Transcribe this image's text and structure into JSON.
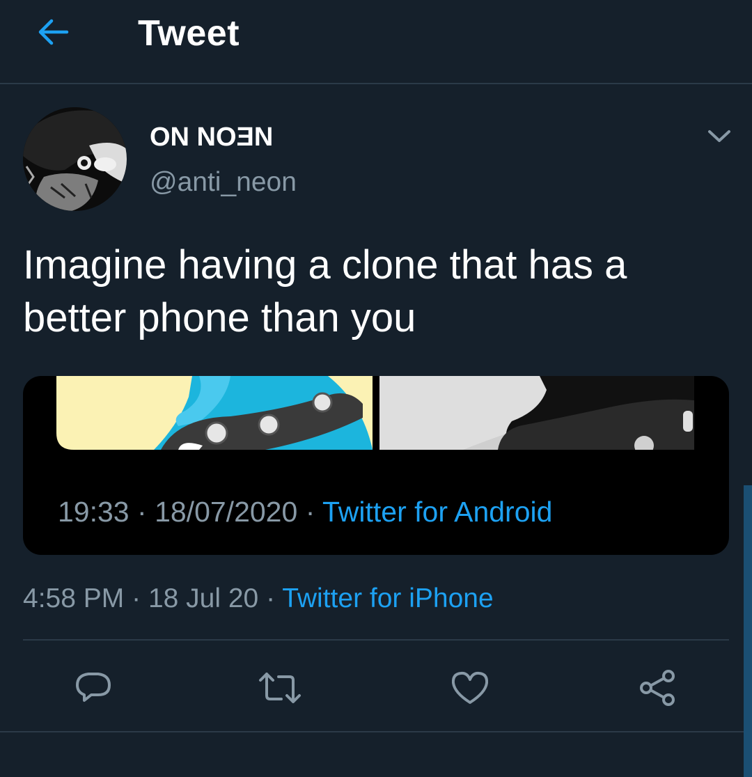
{
  "header": {
    "title": "Tweet",
    "back_icon": "arrow-left-icon"
  },
  "colors": {
    "background": "#15202b",
    "accent": "#1da1f2",
    "secondary_text": "#8899a6",
    "divider": "#2b3a48"
  },
  "tweet": {
    "display_name": "ON NOƎN",
    "handle": "@anti_neon",
    "text_lines": [
      "Imagine having a clone that has a",
      "better phone than you"
    ],
    "media": {
      "time": "19:33",
      "date": "18/07/2020",
      "separator": "·",
      "source": "Twitter for Android"
    },
    "time": "4:58 PM",
    "date": "18 Jul 20",
    "separator": "·",
    "source": "Twitter for iPhone"
  },
  "actions": [
    {
      "name": "reply",
      "icon": "reply-icon"
    },
    {
      "name": "retweet",
      "icon": "retweet-icon"
    },
    {
      "name": "like",
      "icon": "heart-icon"
    },
    {
      "name": "share",
      "icon": "share-icon"
    }
  ]
}
